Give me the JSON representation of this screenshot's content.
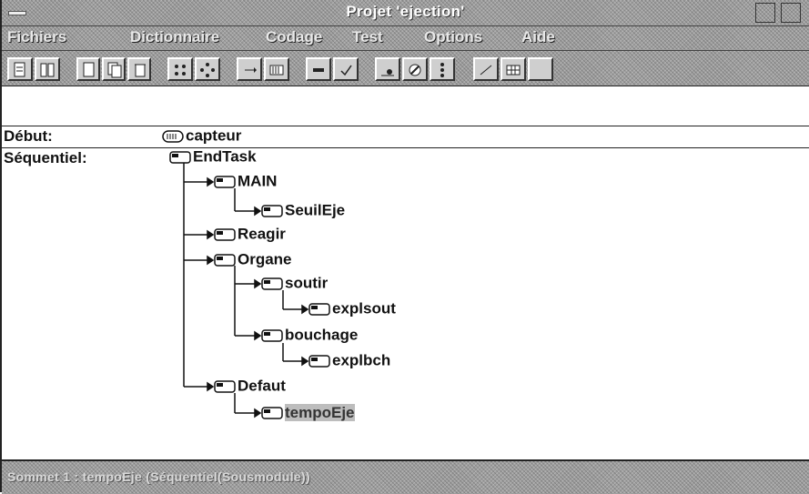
{
  "window": {
    "title": "Projet 'ejection'"
  },
  "menubar": {
    "items": [
      "Fichiers",
      "Dictionnaire",
      "Codage",
      "Test",
      "Options",
      "Aide"
    ]
  },
  "toolbar": {
    "buttons": [
      "new-file-icon",
      "open-icon",
      "page-icon",
      "copy-icon",
      "delete-icon",
      "grid-icon",
      "move-icon",
      "insert-icon",
      "barcode-icon",
      "dash-icon",
      "check-icon",
      "point-icon",
      "edit-icon",
      "dots-icon",
      "line-icon",
      "table-icon",
      "blank-icon"
    ]
  },
  "tree": {
    "debut_label": "Début:",
    "debut_item": "capteur",
    "sequentiel_label": "Séquentiel:",
    "nodes": [
      "EndTask",
      "MAIN",
      "SeuilEje",
      "Reagir",
      "Organe",
      "soutir",
      "explsout",
      "bouchage",
      "explbch",
      "Defaut",
      "tempoEje"
    ],
    "selected": "tempoEje"
  },
  "statusbar": {
    "text": "Sommet 1 : tempoEje (Séquentiel(Sousmodule))"
  },
  "colors": {
    "chrome_gray": "#9e9e9e",
    "text": "#111111",
    "highlight": "#bdbdbd"
  }
}
